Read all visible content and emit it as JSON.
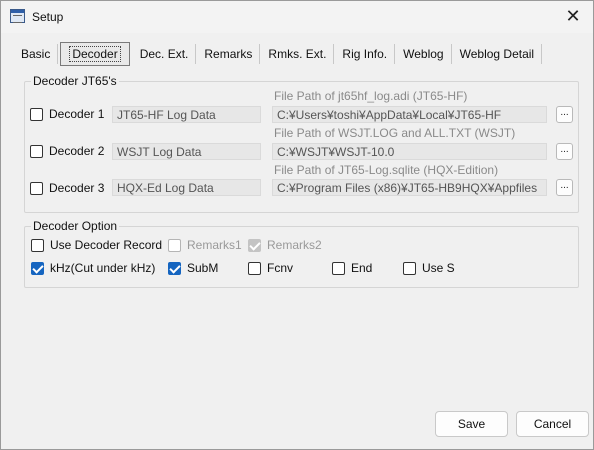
{
  "window": {
    "title": "Setup",
    "close_glyph": "✕"
  },
  "tabs": [
    {
      "label": "Basic"
    },
    {
      "label": "Decoder"
    },
    {
      "label": "Dec. Ext."
    },
    {
      "label": "Remarks"
    },
    {
      "label": "Rmks. Ext."
    },
    {
      "label": "Rig Info."
    },
    {
      "label": "Weblog"
    },
    {
      "label": "Weblog Detail"
    }
  ],
  "decoder_group": {
    "label": "Decoder JT65's",
    "rows": [
      {
        "checkbox_label": "Decoder 1",
        "checked": false,
        "name": "JT65-HF Log Data",
        "path_label": "File Path of jt65hf_log.adi (JT65-HF)",
        "path": "C:¥Users¥toshi¥AppData¥Local¥JT65-HF",
        "browse_label": "..."
      },
      {
        "checkbox_label": "Decoder 2",
        "checked": false,
        "name": "WSJT Log Data",
        "path_label": "File Path of WSJT.LOG and ALL.TXT (WSJT)",
        "path": "C:¥WSJT¥WSJT-10.0",
        "browse_label": "..."
      },
      {
        "checkbox_label": "Decoder 3",
        "checked": false,
        "name": "HQX-Ed Log Data",
        "path_label": "File Path of JT65-Log.sqlite (HQX-Edition)",
        "path": "C:¥Program Files (x86)¥JT65-HB9HQX¥Appfiles",
        "browse_label": "..."
      }
    ]
  },
  "option_group": {
    "label": "Decoder Option",
    "use_record": {
      "label": "Use Decoder Record",
      "checked": false
    },
    "remarks1": {
      "label": "Remarks1",
      "checked": false,
      "enabled": false
    },
    "remarks2": {
      "label": "Remarks2",
      "checked": true,
      "enabled": false
    },
    "khz": {
      "label": "kHz(Cut under kHz)",
      "checked": true
    },
    "subm": {
      "label": "SubM",
      "checked": true
    },
    "fcnv": {
      "label": "Fcnv",
      "checked": false
    },
    "end": {
      "label": "End",
      "checked": false
    },
    "use_s": {
      "label": "Use S",
      "checked": false
    }
  },
  "buttons": {
    "save": "Save",
    "cancel": "Cancel"
  },
  "colors": {
    "accent": "#1565c0",
    "background": "#f0f0f0"
  }
}
